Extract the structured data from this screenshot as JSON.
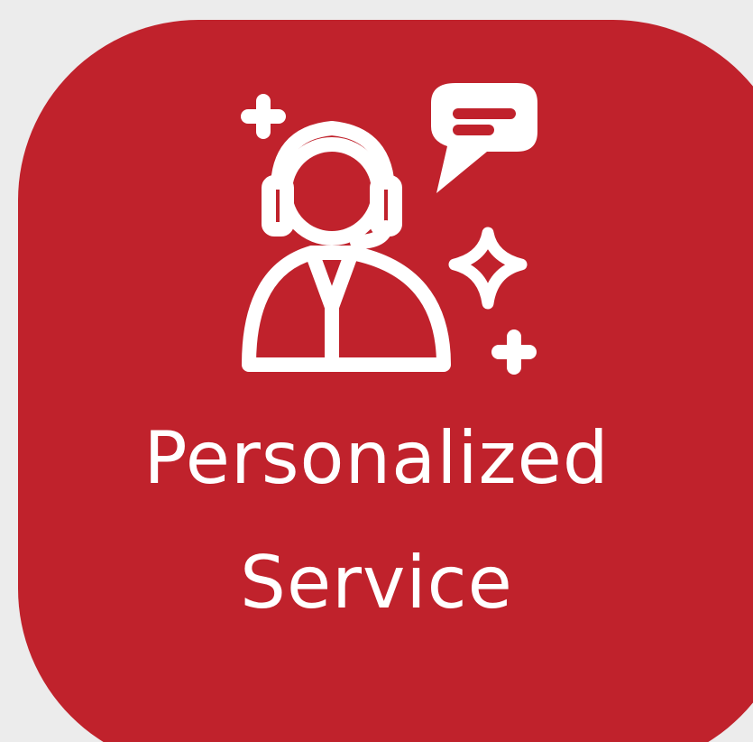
{
  "card": {
    "icon": "customer-service-agent-icon",
    "title_line1": "Personalized",
    "title_line2": "Service"
  },
  "colors": {
    "card_background": "#c0222c",
    "page_background": "#ececec",
    "foreground": "#ffffff"
  }
}
